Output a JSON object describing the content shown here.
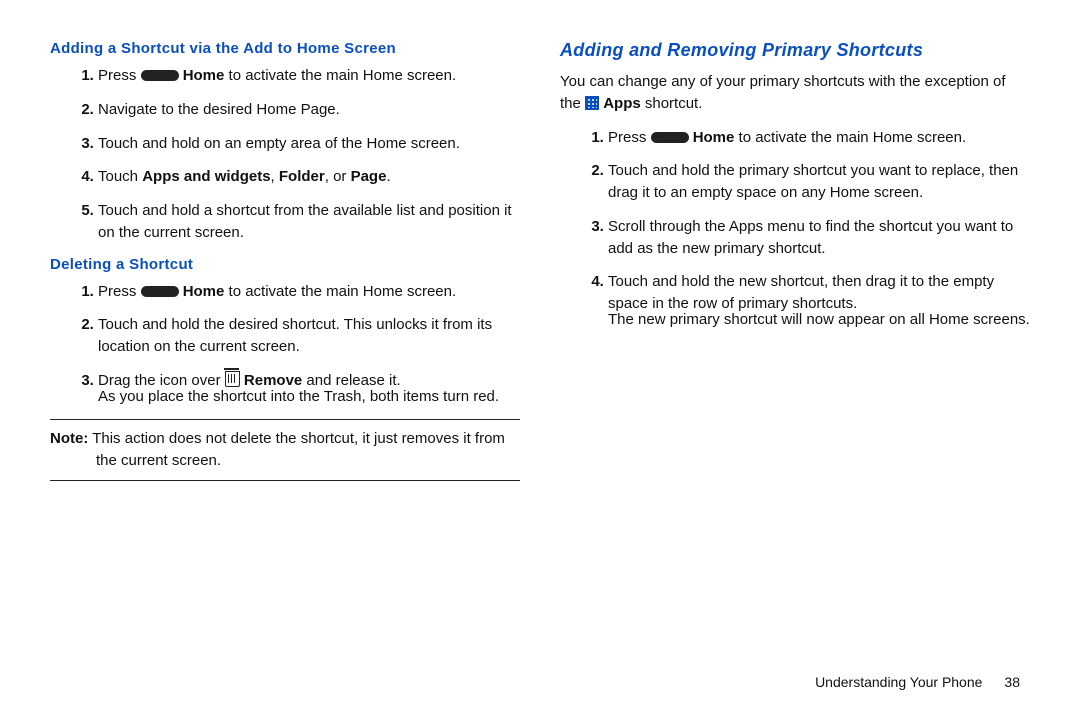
{
  "left": {
    "heading1": "Adding a Shortcut via the Add to Home Screen",
    "list1": {
      "i1_pre": "Press ",
      "i1_home": "Home",
      "i1_post": " to activate the main Home screen.",
      "i2": "Navigate to the desired Home Page.",
      "i3": "Touch and hold on an empty area of the Home screen.",
      "i4_pre": "Touch ",
      "i4_b1": "Apps and widgets",
      "i4_mid1": ", ",
      "i4_b2": "Folder",
      "i4_mid2": ", or ",
      "i4_b3": "Page",
      "i4_post": ".",
      "i5": "Touch and hold a shortcut from the available list and position it on the current screen."
    },
    "heading2": "Deleting a Shortcut",
    "list2": {
      "i1_pre": "Press ",
      "i1_home": "Home",
      "i1_post": " to activate the main Home screen.",
      "i2": "Touch and hold the desired shortcut. This unlocks it from its location on the current screen.",
      "i3_pre": "Drag the icon over ",
      "i3_b": "Remove",
      "i3_post": " and release it.",
      "i3_sub": "As you place the shortcut into the Trash, both items turn red."
    },
    "note_label": "Note:",
    "note_text": " This action does not delete the shortcut, it just removes it from the current screen."
  },
  "right": {
    "heading": "Adding and Removing Primary Shortcuts",
    "intro_pre": "You can change any of your primary shortcuts with the exception of the ",
    "intro_b": "Apps",
    "intro_post": " shortcut.",
    "list": {
      "i1_pre": "Press ",
      "i1_home": "Home",
      "i1_post": " to activate the main Home screen.",
      "i2": "Touch and hold the primary shortcut you want to replace, then drag it to an empty space on any Home screen.",
      "i3": "Scroll through the Apps menu to find the shortcut you want to add as the new primary shortcut.",
      "i4": "Touch and hold the new shortcut, then drag it to the empty space in the row of primary shortcuts.",
      "i4_sub": "The new primary shortcut will now appear on all Home screens."
    }
  },
  "footer": {
    "section": "Understanding Your Phone",
    "page": "38"
  }
}
